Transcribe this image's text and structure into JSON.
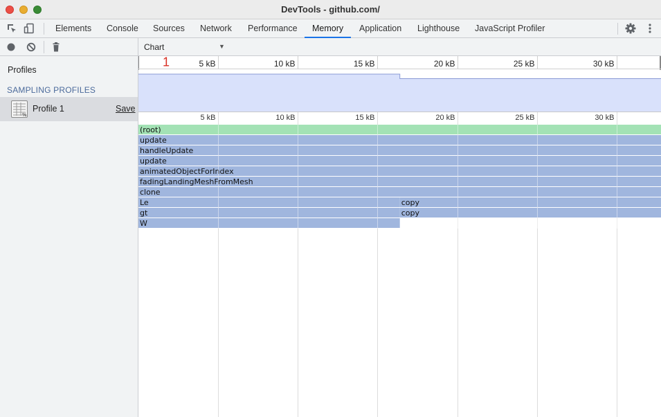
{
  "window": {
    "title": "DevTools - github.com/"
  },
  "tabs": [
    "Elements",
    "Console",
    "Sources",
    "Network",
    "Performance",
    "Memory",
    "Application",
    "Lighthouse",
    "JavaScript Profiler"
  ],
  "active_tab": "Memory",
  "toolbar": {
    "view_select": "Chart",
    "marker": "1"
  },
  "sidebar": {
    "title": "Profiles",
    "section": "SAMPLING PROFILES",
    "profile_name": "Profile 1",
    "save_label": "Save"
  },
  "ruler_ticks": [
    "5 kB",
    "10 kB",
    "15 kB",
    "20 kB",
    "25 kB",
    "30 kB"
  ],
  "flame_rows": [
    [
      {
        "name": "(root)",
        "start_kb": 0,
        "end_kb": 32.8,
        "color": "#a3e2b5"
      }
    ],
    [
      {
        "name": "update",
        "start_kb": 0,
        "end_kb": 32.8,
        "color": "#a0b6de"
      }
    ],
    [
      {
        "name": "handleUpdate",
        "start_kb": 0,
        "end_kb": 32.8,
        "color": "#a0b6de"
      }
    ],
    [
      {
        "name": "update",
        "start_kb": 0,
        "end_kb": 32.8,
        "color": "#a0b6de"
      }
    ],
    [
      {
        "name": "animatedObjectForIndex",
        "start_kb": 0,
        "end_kb": 32.8,
        "color": "#a0b6de"
      }
    ],
    [
      {
        "name": "fadingLandingMeshFromMesh",
        "start_kb": 0,
        "end_kb": 32.8,
        "color": "#a0b6de"
      }
    ],
    [
      {
        "name": "clone",
        "start_kb": 0,
        "end_kb": 32.8,
        "color": "#a0b6de"
      }
    ],
    [
      {
        "name": "Le",
        "start_kb": 0,
        "end_kb": 16.4,
        "color": "#a0b6de"
      },
      {
        "name": "copy",
        "start_kb": 16.4,
        "end_kb": 32.8,
        "color": "#a0b6de"
      }
    ],
    [
      {
        "name": "gt",
        "start_kb": 0,
        "end_kb": 16.4,
        "color": "#a0b6de"
      },
      {
        "name": "copy",
        "start_kb": 16.4,
        "end_kb": 32.8,
        "color": "#a0b6de"
      }
    ],
    [
      {
        "name": "W",
        "start_kb": 0,
        "end_kb": 16.4,
        "color": "#a0b6de"
      }
    ]
  ],
  "overview_area": [
    {
      "x_kb": 0,
      "level": 1.0
    },
    {
      "x_kb": 16.4,
      "level": 1.0
    },
    {
      "x_kb": 16.4,
      "level": 0.88
    },
    {
      "x_kb": 32.8,
      "level": 0.88
    }
  ],
  "colors": {
    "accent": "#1a73e8",
    "overview_fill": "#d9e1fb",
    "overview_stroke": "#8a9bd6",
    "marker": "#d93025"
  },
  "icons": [
    "inspect-icon",
    "device-toggle-icon",
    "settings-gear-icon",
    "kebab-menu-icon",
    "record-icon",
    "clear-icon",
    "delete-icon",
    "profile-file-icon",
    "dropdown-arrow-icon"
  ]
}
